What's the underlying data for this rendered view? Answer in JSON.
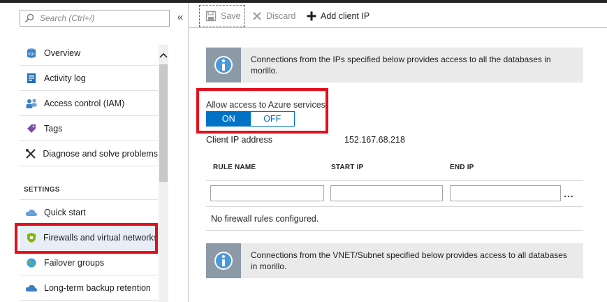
{
  "sidebar": {
    "search_placeholder": "Search (Ctrl+/)",
    "collapse_glyph": "«",
    "items_top": [
      {
        "label": "Overview",
        "icon": "sql-database-icon"
      },
      {
        "label": "Activity log",
        "icon": "activity-log-icon"
      },
      {
        "label": "Access control (IAM)",
        "icon": "people-icon"
      },
      {
        "label": "Tags",
        "icon": "tag-icon"
      },
      {
        "label": "Diagnose and solve problems",
        "icon": "wrench-icon"
      }
    ],
    "section_label": "SETTINGS",
    "items_settings": [
      {
        "label": "Quick start",
        "icon": "cloud-icon"
      },
      {
        "label": "Firewalls and virtual networks",
        "icon": "shield-icon"
      },
      {
        "label": "Failover groups",
        "icon": "globe-icon"
      },
      {
        "label": "Long-term backup retention",
        "icon": "cloud-backup-icon"
      }
    ],
    "selected_item": "Firewalls and virtual networks"
  },
  "toolbar": {
    "save_label": "Save",
    "discard_label": "Discard",
    "add_client_ip_label": "Add client IP"
  },
  "main": {
    "info_banner_1": "Connections from the IPs specified below provides access to all the databases in morillo.",
    "allow_azure_label": "Allow access to Azure services",
    "toggle_on": "ON",
    "toggle_off": "OFF",
    "toggle_state": "ON",
    "client_ip_label": "Client IP address",
    "client_ip_value": "152.167.68.218",
    "rules_headers": [
      "RULE NAME",
      "START IP",
      "END IP"
    ],
    "more_glyph": "...",
    "no_rules_text": "No firewall rules configured.",
    "info_banner_2": "Connections from the VNET/Subnet specified below provides access to all databases in morillo."
  },
  "colors": {
    "accent": "#0072c6",
    "highlight": "#e3101c",
    "info_box": "#8c99a6",
    "banner_bg": "#eaeaea"
  }
}
